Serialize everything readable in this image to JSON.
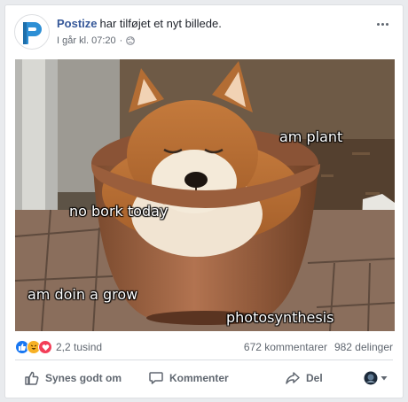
{
  "post": {
    "author": "Postize",
    "action": "har tilføjet et nyt billede.",
    "timestamp": "I går kl. 07:20",
    "privacy_icon": "globe-icon"
  },
  "image": {
    "captions": {
      "am_plant": "am plant",
      "no_bork": "no bork today",
      "doin_grow": "am doin a grow",
      "photosynthesis": "photosynthesis"
    }
  },
  "stats": {
    "reaction_icons": [
      "like-reaction-icon",
      "haha-reaction-icon",
      "love-reaction-icon"
    ],
    "reaction_count": "2,2 tusind",
    "comments": "672 kommentarer",
    "shares": "982 delinger"
  },
  "actions": {
    "like": "Synes godt om",
    "comment": "Kommenter",
    "share": "Del"
  },
  "colors": {
    "author_link": "#365899",
    "like_blue": "#1877f2",
    "love_red": "#f33e58",
    "haha_yellow": "#f7b125"
  }
}
